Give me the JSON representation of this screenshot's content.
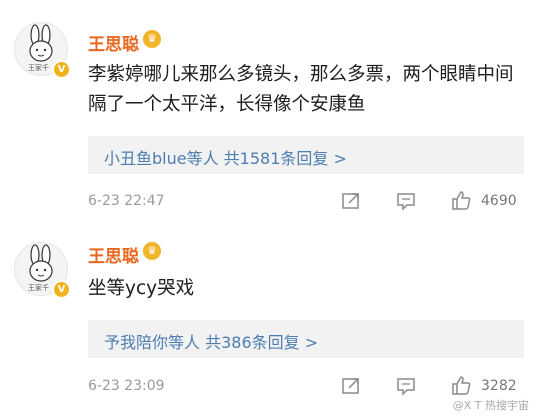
{
  "comments": [
    {
      "username": "王思聪",
      "avatar_caption": "王家千",
      "text": "李紫婷哪儿来那么多镜头，那么多票，两个眼睛中间隔了一个太平洋，长得像个安康鱼",
      "reply_summary": "小丑鱼blue等人  共1581条回复 >",
      "time": "6-23 22:47",
      "likes": "4690"
    },
    {
      "username": "王思聪",
      "avatar_caption": "王家千",
      "text": "坐等ycy哭戏",
      "reply_summary": "予我陪你等人  共386条回复 >",
      "time": "6-23 23:09",
      "likes": "3282"
    }
  ],
  "icons": {
    "verified": "v-badge-icon",
    "level": "crown-badge-icon",
    "share": "share-icon",
    "comment": "comment-icon",
    "like": "thumbs-up-icon"
  },
  "watermark": "@X T 热搜宇宙",
  "colors": {
    "username": "#e8681f",
    "link": "#4e7db0",
    "meta": "#9a9a9a",
    "badge": "#f3b21b"
  }
}
